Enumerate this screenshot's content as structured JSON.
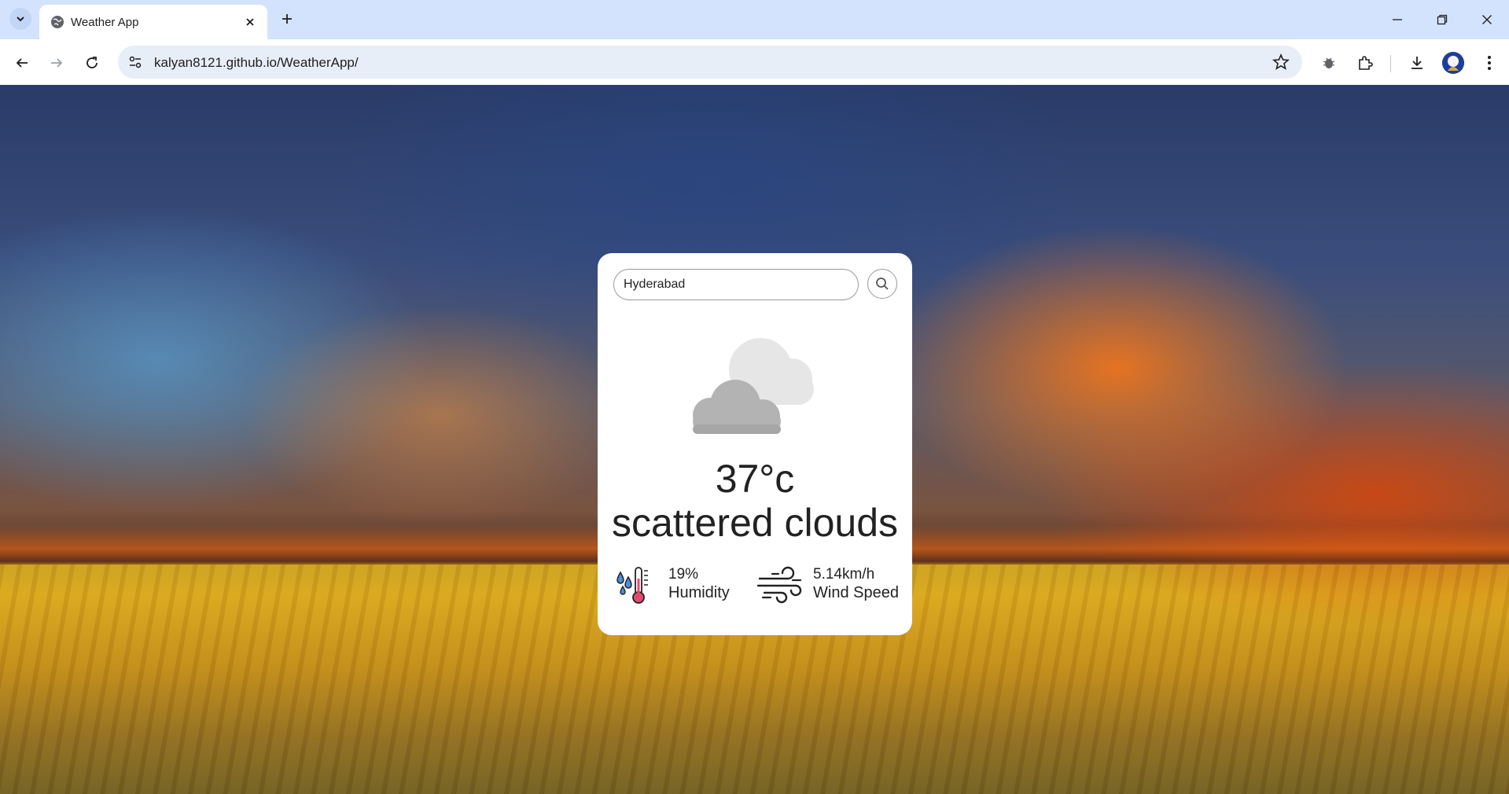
{
  "browser": {
    "tab_title": "Weather App",
    "url": "kalyan8121.github.io/WeatherApp/"
  },
  "app": {
    "search": {
      "value": "Hyderabad"
    },
    "weather_icon": "scattered-clouds-icon",
    "temperature": "37°c",
    "description": "scattered clouds",
    "humidity": {
      "value": "19%",
      "label": "Humidity",
      "icon": "humidity-thermometer-icon"
    },
    "wind": {
      "value": "5.14km/h",
      "label": "Wind Speed",
      "icon": "wind-icon"
    }
  },
  "colors": {
    "browser_tabbar": "#d3e3fd",
    "card_background": "#ffffff",
    "text": "#222222"
  }
}
